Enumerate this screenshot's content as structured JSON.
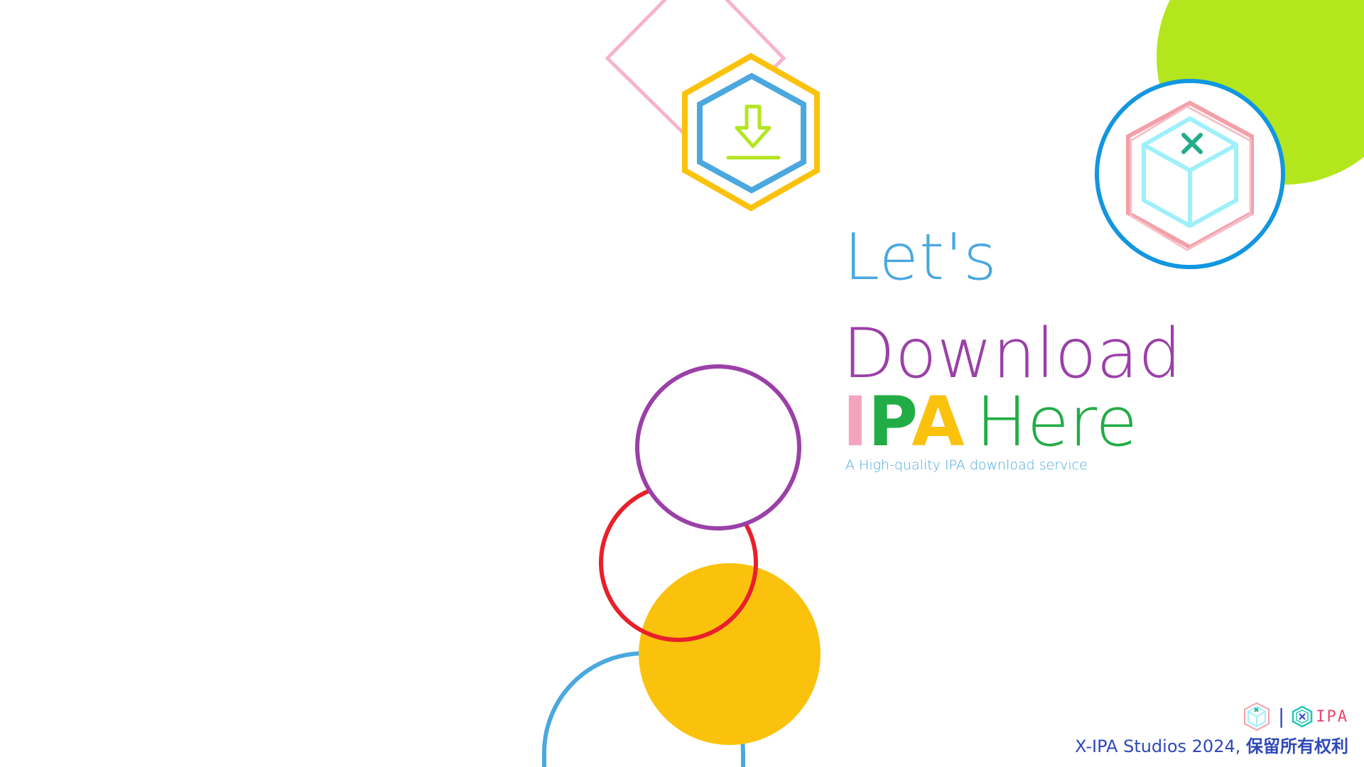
{
  "hero": {
    "line1": "Let's",
    "line2": "Download",
    "ipa_letters": [
      "I",
      "P",
      "A"
    ],
    "line3_rest": "Here",
    "tagline": "A High-quality IPA download service"
  },
  "footer": {
    "separator": "|",
    "brand_text": "IPA",
    "copyright_prefix": "X-IPA Studios 2024,",
    "copyright_reserved": "保留所有权利"
  },
  "icons": {
    "download": "download-icon",
    "box": "box-x-icon",
    "brand_box": "brand-box-icon",
    "brand_hex": "brand-hex-x-icon"
  },
  "colors": {
    "blue": "#4aa8df",
    "purple": "#9b40a8",
    "green": "#22ac46",
    "yellow": "#fbc20d",
    "pink": "#f4a5bd",
    "lime": "#b3e61d",
    "red": "#e8202a",
    "navy": "#2f49b8"
  }
}
